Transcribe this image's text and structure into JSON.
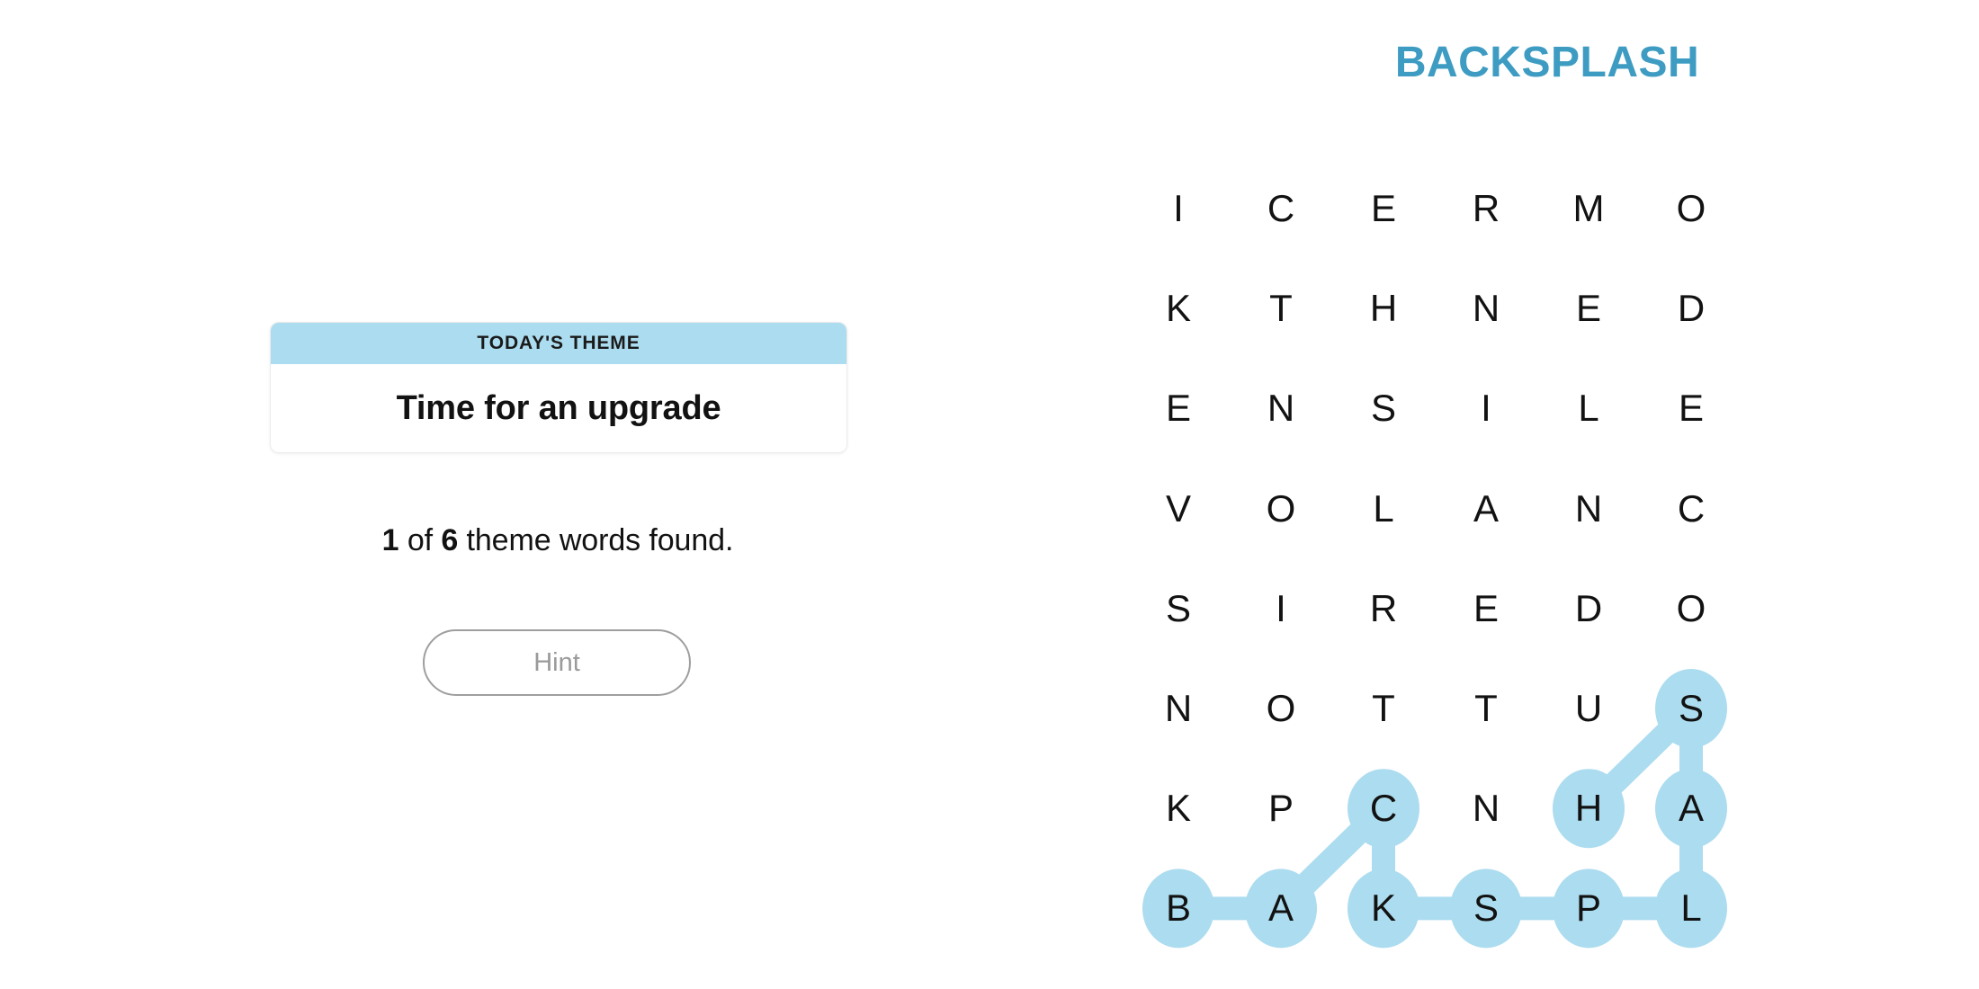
{
  "puzzle": {
    "title": "BACKSPLASH",
    "title_color": "#3E9CC3",
    "highlight_color": "#ACDCEF",
    "rows": 8,
    "cols": 6,
    "grid": [
      [
        "I",
        "C",
        "E",
        "R",
        "M",
        "O"
      ],
      [
        "K",
        "T",
        "H",
        "N",
        "E",
        "D"
      ],
      [
        "E",
        "N",
        "S",
        "I",
        "L",
        "E"
      ],
      [
        "V",
        "O",
        "L",
        "A",
        "N",
        "C"
      ],
      [
        "S",
        "I",
        "R",
        "E",
        "D",
        "O"
      ],
      [
        "N",
        "O",
        "T",
        "T",
        "U",
        "S"
      ],
      [
        "K",
        "P",
        "C",
        "N",
        "H",
        "A"
      ],
      [
        "B",
        "A",
        "K",
        "S",
        "P",
        "L"
      ]
    ],
    "selected_path": [
      {
        "row": 8,
        "col": 1,
        "letter": "B"
      },
      {
        "row": 8,
        "col": 2,
        "letter": "A"
      },
      {
        "row": 7,
        "col": 3,
        "letter": "C"
      },
      {
        "row": 8,
        "col": 3,
        "letter": "K"
      },
      {
        "row": 8,
        "col": 4,
        "letter": "S"
      },
      {
        "row": 8,
        "col": 5,
        "letter": "P"
      },
      {
        "row": 8,
        "col": 6,
        "letter": "L"
      },
      {
        "row": 7,
        "col": 6,
        "letter": "A"
      },
      {
        "row": 6,
        "col": 6,
        "letter": "S"
      },
      {
        "row": 7,
        "col": 5,
        "letter": "H"
      }
    ]
  },
  "theme_card": {
    "header_label": "TODAY'S THEME",
    "theme_text": "Time for an upgrade"
  },
  "progress": {
    "found_count": "1",
    "mid_text": " of ",
    "total_count": "6",
    "suffix_text": " theme words found."
  },
  "hint": {
    "label": "Hint"
  }
}
